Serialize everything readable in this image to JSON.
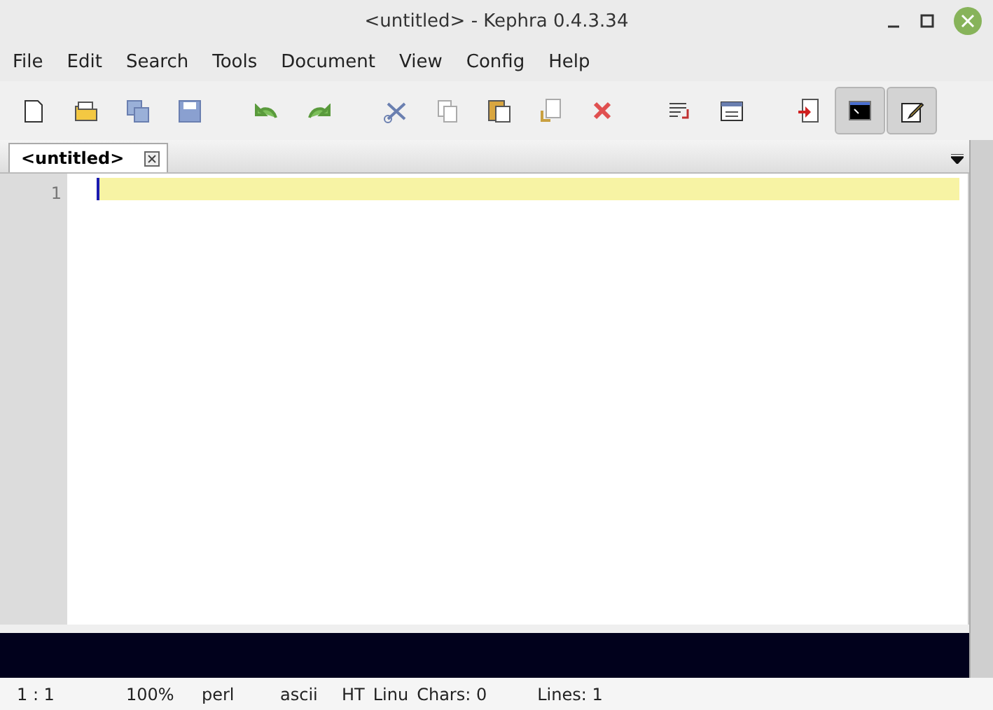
{
  "window": {
    "title": "<untitled> - Kephra 0.4.3.34"
  },
  "menu": [
    "File",
    "Edit",
    "Search",
    "Tools",
    "Document",
    "View",
    "Config",
    "Help"
  ],
  "toolbar": [
    [
      {
        "kind": "new",
        "pressed": false
      },
      {
        "kind": "open",
        "pressed": false
      },
      {
        "kind": "save-all",
        "pressed": false
      },
      {
        "kind": "save",
        "pressed": false
      }
    ],
    [
      {
        "kind": "undo",
        "pressed": false
      },
      {
        "kind": "redo",
        "pressed": false
      }
    ],
    [
      {
        "kind": "cut",
        "pressed": false
      },
      {
        "kind": "copy",
        "pressed": false
      },
      {
        "kind": "paste",
        "pressed": false
      },
      {
        "kind": "replace",
        "pressed": false
      },
      {
        "kind": "delete",
        "pressed": false
      }
    ],
    [
      {
        "kind": "wrap",
        "pressed": false
      },
      {
        "kind": "window",
        "pressed": false
      }
    ],
    [
      {
        "kind": "export",
        "pressed": false
      },
      {
        "kind": "terminal",
        "pressed": true
      },
      {
        "kind": "edit",
        "pressed": true
      }
    ]
  ],
  "tabs": [
    {
      "label": "<untitled>",
      "selected": true
    }
  ],
  "editor": {
    "line_numbers": [
      "1"
    ]
  },
  "status_bar": [
    "1 : 1",
    "100%",
    "perl",
    "ascii",
    "HT",
    "Linu",
    "Chars: 0",
    "Lines: 1"
  ]
}
